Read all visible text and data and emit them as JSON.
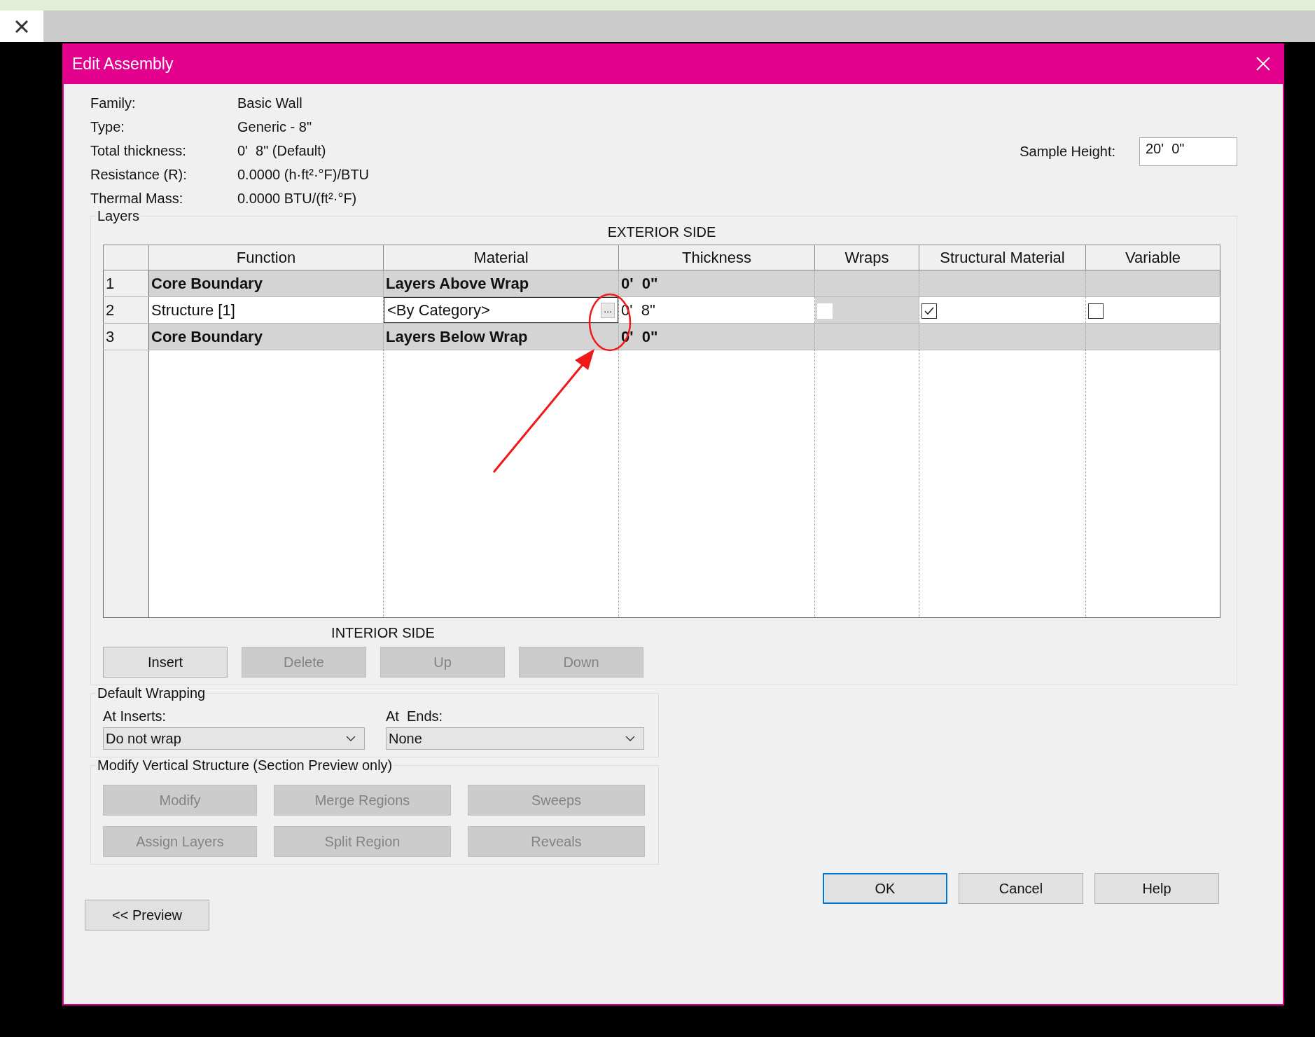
{
  "dialog": {
    "title": "Edit Assembly"
  },
  "info": [
    {
      "label": "Family:",
      "value": "Basic Wall"
    },
    {
      "label": "Type:",
      "value": "Generic - 8\""
    },
    {
      "label": "Total thickness:",
      "value": "0'  8\" (Default)"
    },
    {
      "label": "Resistance (R):",
      "value": "0.0000 (h·ft²·°F)/BTU"
    },
    {
      "label": "Thermal Mass:",
      "value": "0.0000 BTU/(ft²·°F)"
    }
  ],
  "sample_height": {
    "label": "Sample Height:",
    "value": "20'  0\""
  },
  "layers": {
    "title": "Layers",
    "top_caption": "EXTERIOR SIDE",
    "bottom_caption": "INTERIOR SIDE",
    "columns": [
      "Function",
      "Material",
      "Thickness",
      "Wraps",
      "Structural Material",
      "Variable"
    ],
    "rows": [
      {
        "number": "1",
        "kind": "boundary",
        "function": "Core Boundary",
        "material": "Layers Above Wrap",
        "thickness": "0'  0\""
      },
      {
        "number": "2",
        "kind": "layer",
        "function": "Structure [1]",
        "material": "<By Category>",
        "browse_button": "...",
        "thickness": "0'  8\"",
        "wraps": {
          "checked": false,
          "disabled": true
        },
        "structural_material": {
          "checked": true,
          "disabled": false
        },
        "variable": {
          "checked": false,
          "disabled": false
        }
      },
      {
        "number": "3",
        "kind": "boundary",
        "function": "Core Boundary",
        "material": "Layers Below Wrap",
        "thickness": "0'  0\""
      }
    ],
    "buttons": [
      {
        "label": "Insert",
        "disabled": false
      },
      {
        "label": "Delete",
        "disabled": true
      },
      {
        "label": "Up",
        "disabled": true
      },
      {
        "label": "Down",
        "disabled": true
      }
    ]
  },
  "default_wrapping": {
    "title": "Default Wrapping",
    "at_inserts": {
      "label": "At Inserts:",
      "value": "Do not wrap"
    },
    "at_ends": {
      "label": "At  Ends:",
      "value": "None"
    }
  },
  "modify_vertical_structure": {
    "title": "Modify Vertical Structure (Section Preview only)",
    "buttons": [
      {
        "label": "Modify",
        "disabled": true
      },
      {
        "label": "Merge Regions",
        "disabled": true
      },
      {
        "label": "Sweeps",
        "disabled": true
      },
      {
        "label": "Assign Layers",
        "disabled": true
      },
      {
        "label": "Split Region",
        "disabled": true
      },
      {
        "label": "Reveals",
        "disabled": true
      }
    ]
  },
  "preview_button": {
    "label": "<< Preview"
  },
  "dialog_buttons": [
    {
      "label": "OK",
      "focused": true
    },
    {
      "label": "Cancel",
      "focused": false
    },
    {
      "label": "Help",
      "focused": false
    }
  ]
}
